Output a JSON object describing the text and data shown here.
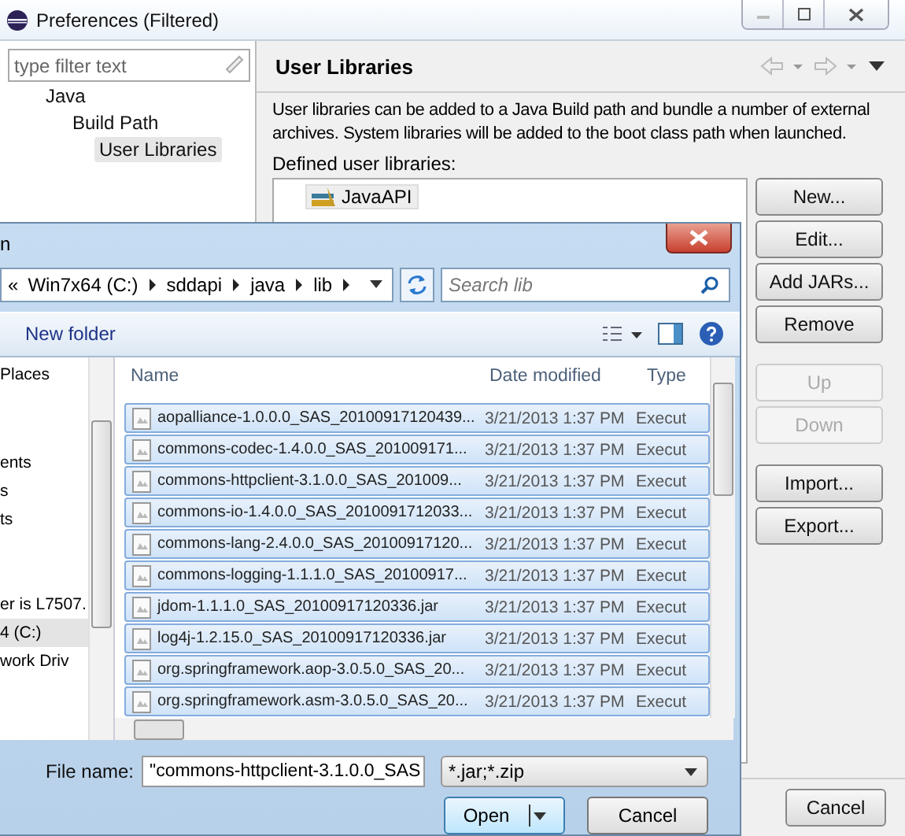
{
  "window": {
    "title": "Preferences (Filtered)"
  },
  "filter": {
    "placeholder": "type filter text"
  },
  "tree": [
    {
      "label": "Java",
      "selected": false,
      "children": [
        {
          "label": "Build Path",
          "selected": false,
          "children": [
            {
              "label": "User Libraries",
              "selected": true
            }
          ]
        }
      ]
    }
  ],
  "page": {
    "title": "User Libraries",
    "description": "User libraries can be added to a Java Build path and bundle a number of external archives. System libraries will be added to the boot class path when launched.",
    "list_label": "Defined user libraries:",
    "libraries": [
      {
        "label": "JavaAPI",
        "selected": true
      }
    ]
  },
  "buttons": [
    {
      "label": "New...",
      "disabled": false
    },
    {
      "label": "Edit...",
      "disabled": false
    },
    {
      "label": "Add JARs...",
      "disabled": false
    },
    {
      "label": "Remove",
      "disabled": false
    },
    {
      "label": "Up",
      "disabled": true
    },
    {
      "label": "Down",
      "disabled": true
    },
    {
      "label": "Import...",
      "disabled": false
    },
    {
      "label": "Export...",
      "disabled": false
    }
  ],
  "cancel": "Cancel",
  "dialog": {
    "title": "n",
    "overflow_glyph": "«",
    "breadcrumb": [
      "Win7x64 (C:)",
      "sddapi",
      "java",
      "lib"
    ],
    "search": {
      "placeholder": "Search lib"
    },
    "new_folder": "New folder",
    "nav": [
      {
        "label": "Places",
        "selected": false
      },
      {
        "label": "ents",
        "selected": false
      },
      {
        "label": "s",
        "selected": false
      },
      {
        "label": "ts",
        "selected": false
      },
      {
        "label": "er is L7507.",
        "selected": false
      },
      {
        "label": "4 (C:)",
        "selected": true
      },
      {
        "label": "work Driv",
        "selected": false
      }
    ],
    "columns": [
      "Name",
      "Date modified",
      "Type"
    ],
    "rows": [
      {
        "name": "aopalliance-1.0.0.0_SAS_20100917120439...",
        "date": "3/21/2013 1:37 PM",
        "type": "Execut",
        "selected": true
      },
      {
        "name": "commons-codec-1.4.0.0_SAS_201009171...",
        "date": "3/21/2013 1:37 PM",
        "type": "Execut",
        "selected": true
      },
      {
        "name": "commons-httpclient-3.1.0.0_SAS_201009...",
        "date": "3/21/2013 1:37 PM",
        "type": "Execut",
        "selected": true
      },
      {
        "name": "commons-io-1.4.0.0_SAS_2010091712033...",
        "date": "3/21/2013 1:37 PM",
        "type": "Execut",
        "selected": true
      },
      {
        "name": "commons-lang-2.4.0.0_SAS_20100917120...",
        "date": "3/21/2013 1:37 PM",
        "type": "Execut",
        "selected": true
      },
      {
        "name": "commons-logging-1.1.1.0_SAS_20100917...",
        "date": "3/21/2013 1:37 PM",
        "type": "Execut",
        "selected": true
      },
      {
        "name": "jdom-1.1.1.0_SAS_20100917120336.jar",
        "date": "3/21/2013 1:37 PM",
        "type": "Execut",
        "selected": true
      },
      {
        "name": "log4j-1.2.15.0_SAS_20100917120336.jar",
        "date": "3/21/2013 1:37 PM",
        "type": "Execut",
        "selected": true
      },
      {
        "name": "org.springframework.aop-3.0.5.0_SAS_20...",
        "date": "3/21/2013 1:37 PM",
        "type": "Execut",
        "selected": true
      },
      {
        "name": "org.springframework.asm-3.0.5.0_SAS_20...",
        "date": "3/21/2013 1:37 PM",
        "type": "Execut",
        "selected": true
      }
    ],
    "file_name_label": "File name:",
    "file_name": "\"commons-httpclient-3.1.0.0_SAS",
    "file_type": "*.jar;*.zip",
    "open": "Open",
    "cancel": "Cancel"
  }
}
